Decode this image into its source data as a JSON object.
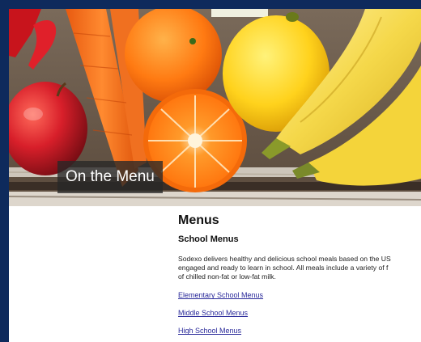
{
  "hero": {
    "caption": "On the Menu"
  },
  "main": {
    "title": "Menus",
    "section_title": "School Menus",
    "intro_lines": [
      "Sodexo delivers healthy and delicious school meals based on the US",
      "engaged and ready to learn in school. All meals include a variety of f",
      "of chilled non-fat or low-fat milk."
    ],
    "links": [
      "Elementary School Menus",
      "Middle School Menus",
      "High School Menus"
    ]
  },
  "colors": {
    "page_border": "#0e2a5c",
    "link": "#2a2a9a",
    "caption_bg": "#282828"
  }
}
